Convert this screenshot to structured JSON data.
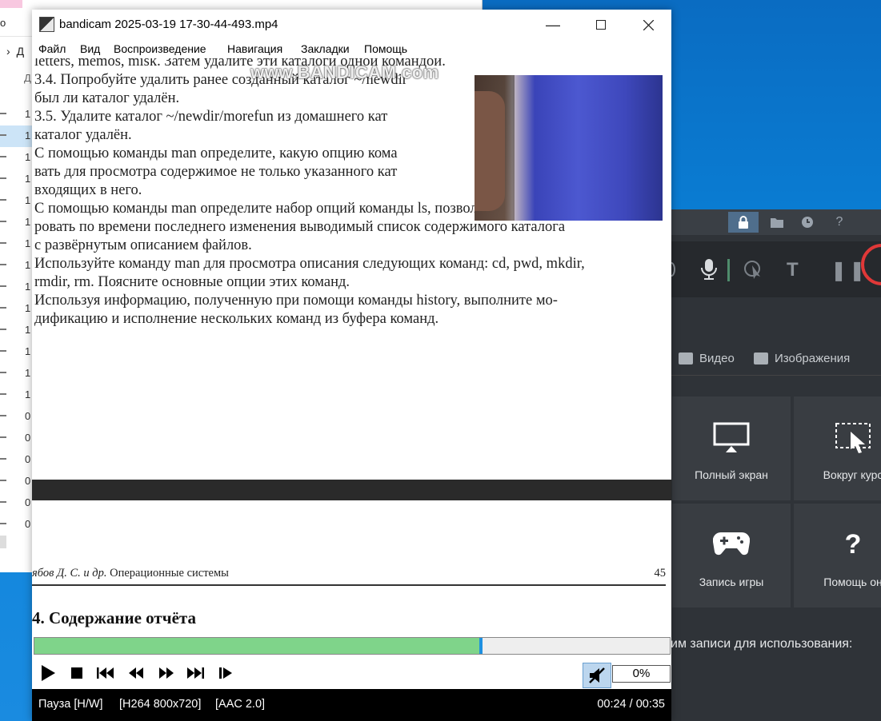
{
  "explorer": {
    "crumb": "Д",
    "header_col": "Д",
    "rows": [
      "1",
      "1",
      "1",
      "1",
      "1",
      "1",
      "1",
      "1",
      "1",
      "1",
      "1",
      "1",
      "1",
      "1",
      "0",
      "0",
      "0",
      "0",
      "0",
      "0"
    ],
    "partial_label": "о"
  },
  "player": {
    "title": "bandicam 2025-03-19 17-30-44-493.mp4",
    "menu": [
      "Файл",
      "Вид",
      "Воспроизведение",
      "Навигация",
      "Закладки",
      "Помощь"
    ],
    "watermark": "www.BANDICAM.com",
    "doc_lines": [
      "letters, memos, misk. Затем удалите эти каталоги одной командой.",
      "3.4.   Попробуйте удалить ранее созданный каталог ~/newdir",
      "           был ли каталог удалён.",
      "3.5.   Удалите каталог ~/newdir/morefun из домашнего кат",
      "           каталог удалён.",
      "С помощью команды man определите, какую опцию кома",
      "вать для просмотра содержимое не только указанного кат",
      "входящих в него.",
      "С помощью команды man определите набор опций команды ls, позволяющих отсорти-",
      "ровать по времени последнего изменения выводимый список содержимого каталога",
      "с развёрнутым описанием файлов.",
      "Используйте команду man для просмотра описания следующих команд: cd, pwd, mkdir,",
      "rmdir, rm. Поясните основные опции этих команд.",
      "Используя информацию, полученную при помощи команды history, выполните мо-",
      "дификацию и исполнение нескольких команд из буфера команд."
    ],
    "running_head_author": "ябов Д. С. и др.",
    "running_head_title": "Операционные системы",
    "page_number": "45",
    "section_title": "4.   Содержание отчёта",
    "progress_fraction": 0.7,
    "volume": "0%",
    "status_state": "Пауза [H/W]",
    "status_video": "[H264 800x720]",
    "status_audio": "[AAC 2.0]",
    "status_time": "00:24 / 00:35"
  },
  "bandicam": {
    "tabs": [
      "Видео",
      "Изображения"
    ],
    "tiles": [
      "Полный экран",
      "Вокруг курс",
      "Запись игры",
      "Помощь он"
    ],
    "footer": "им записи для использования:",
    "toolbar_letter": "T"
  }
}
